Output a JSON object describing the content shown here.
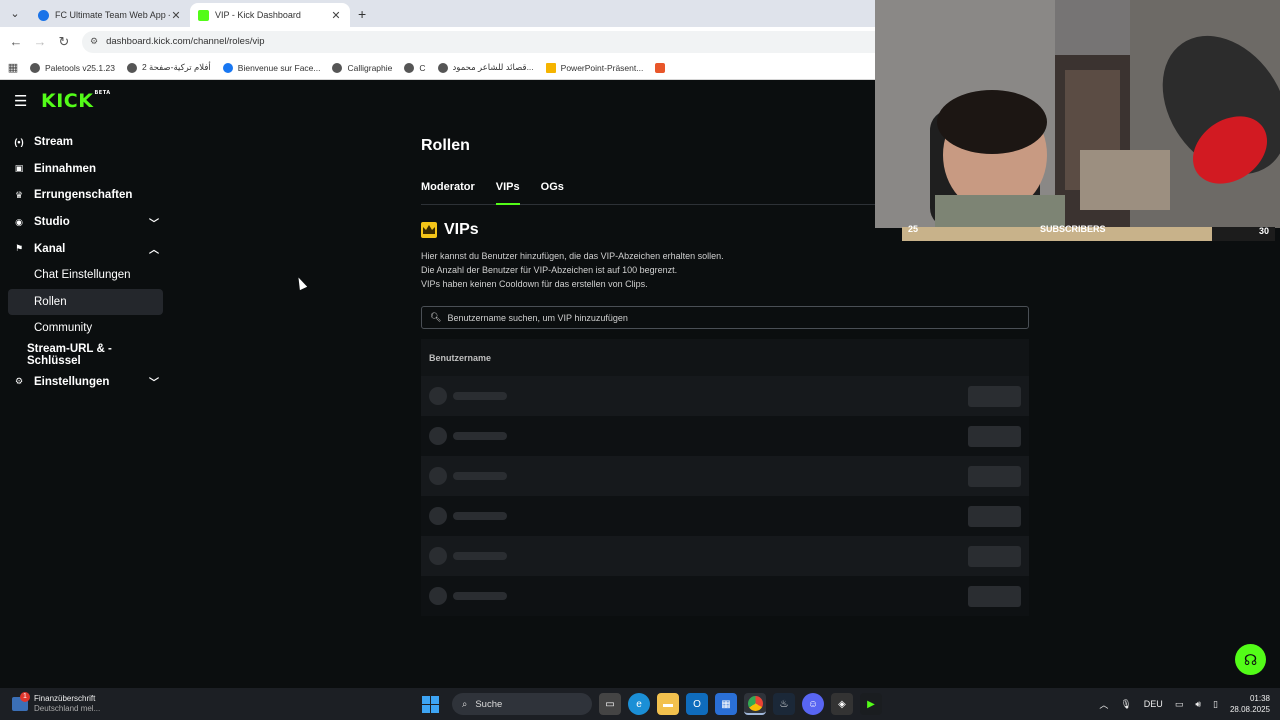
{
  "browser": {
    "tabs": [
      {
        "title": "FC Ultimate Team Web App - E",
        "favicon_color": "#1a73e8",
        "active": false
      },
      {
        "title": "VIP - Kick Dashboard",
        "favicon_color": "#53fc18",
        "active": true
      }
    ],
    "url": "dashboard.kick.com/channel/roles/vip",
    "bookmarks": [
      {
        "label": "Paletools v25.1.23",
        "icon_color": "#555555"
      },
      {
        "label": "أفلام تركية-صفحة 2",
        "icon_color": "#555555"
      },
      {
        "label": "Bienvenue sur Face...",
        "icon_color": "#1877f2"
      },
      {
        "label": "Calligraphie",
        "icon_color": "#555555"
      },
      {
        "label": "C",
        "icon_color": "#555555"
      },
      {
        "label": "قصائد للشاعر محمود...",
        "icon_color": "#555555"
      },
      {
        "label": "PowerPoint-Präsent...",
        "icon_color": "#f5b400"
      },
      {
        "label": "",
        "icon_color": "#e8562a"
      }
    ]
  },
  "kick": {
    "logo": "KICK",
    "logo_badge": "BETA",
    "accent": "#53fc18",
    "sidebar": [
      {
        "label": "Stream",
        "icon": "stream-icon",
        "glyph": "(•)"
      },
      {
        "label": "Einnahmen",
        "icon": "earnings-icon",
        "glyph": "▣"
      },
      {
        "label": "Errungenschaften",
        "icon": "trophy-icon",
        "glyph": "🏆"
      },
      {
        "label": "Studio",
        "icon": "studio-icon",
        "glyph": "◉",
        "chevron": "down"
      },
      {
        "label": "Kanal",
        "icon": "channel-icon",
        "glyph": "☰",
        "chevron": "up"
      },
      {
        "label": "Chat Einstellungen",
        "sub": true
      },
      {
        "label": "Rollen",
        "sub": true,
        "active": true
      },
      {
        "label": "Community",
        "sub": true
      },
      {
        "label": "Stream-URL & -Schlüssel",
        "sub2": true
      },
      {
        "label": "Einstellungen",
        "icon": "gear-icon",
        "glyph": "⚙",
        "chevron": "down"
      }
    ],
    "page_title": "Rollen",
    "role_tabs": [
      {
        "label": "Moderator",
        "active": false
      },
      {
        "label": "VIPs",
        "active": true
      },
      {
        "label": "OGs",
        "active": false
      }
    ],
    "section_title": "VIPs",
    "description": [
      "Hier kannst du Benutzer hinzufügen, die das VIP-Abzeichen erhalten sollen.",
      "Die Anzahl der Benutzer für VIP-Abzeichen ist auf 100 begrenzt.",
      "VIPs haben keinen Cooldown für das erstellen von Clips."
    ],
    "search_placeholder": "Benutzername suchen, um VIP hinzuzufügen",
    "table_header": "Benutzername",
    "skeleton_rows": 6
  },
  "overlay": {
    "subs_current": "25",
    "subs_label": "SUBSCRIBERS",
    "subs_goal": "30",
    "subs_progress": 0.83
  },
  "taskbar": {
    "notification_title": "Finanzüberschrift",
    "notification_sub": "Deutschland mel...",
    "notification_badge": "1",
    "search": "Suche",
    "language": "DEU",
    "time": "01:38",
    "date": "28.08.2025"
  }
}
